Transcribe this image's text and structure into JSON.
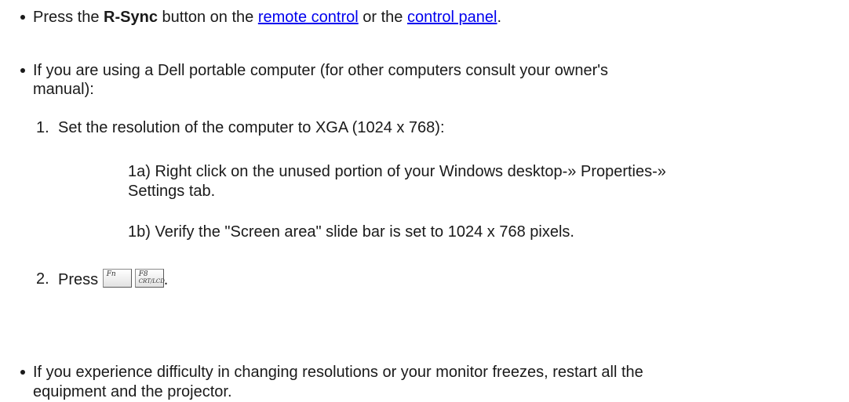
{
  "bullets": {
    "rsync": {
      "prefix": "Press the ",
      "button_name": "R-Sync",
      "middle": " button on the ",
      "remote_link": "remote control",
      "or_text": " or the ",
      "panel_link": "control panel",
      "suffix": "."
    },
    "dell": {
      "line1": "If you are using a Dell portable computer (for other computers consult your owner's",
      "line2": "manual):"
    },
    "trouble": {
      "line1": "If you experience difficulty in changing resolutions or your monitor freezes, restart all the",
      "line2": "equipment and the projector."
    }
  },
  "steps": {
    "step1": {
      "number": "1.",
      "text": "Set the resolution of the computer to XGA (1024 x 768):",
      "sub_a_line1": "1a) Right click on the unused portion of your Windows desktop-» Properties-»",
      "sub_a_line2": "Settings tab.",
      "sub_b": "1b) Verify the \"Screen area\" slide bar is set to 1024 x 768 pixels."
    },
    "step2": {
      "number": "2.",
      "text": "Press",
      "suffix": "."
    }
  },
  "keys": {
    "fn": {
      "label": "Fn",
      "icon": "fn-key-icon"
    },
    "f8": {
      "label": "F8",
      "sublabel": "CRT/LCD",
      "icon": "f8-crt-lcd-key-icon"
    }
  },
  "colors": {
    "text": "#1a1a1a",
    "link": "#0000ee"
  }
}
